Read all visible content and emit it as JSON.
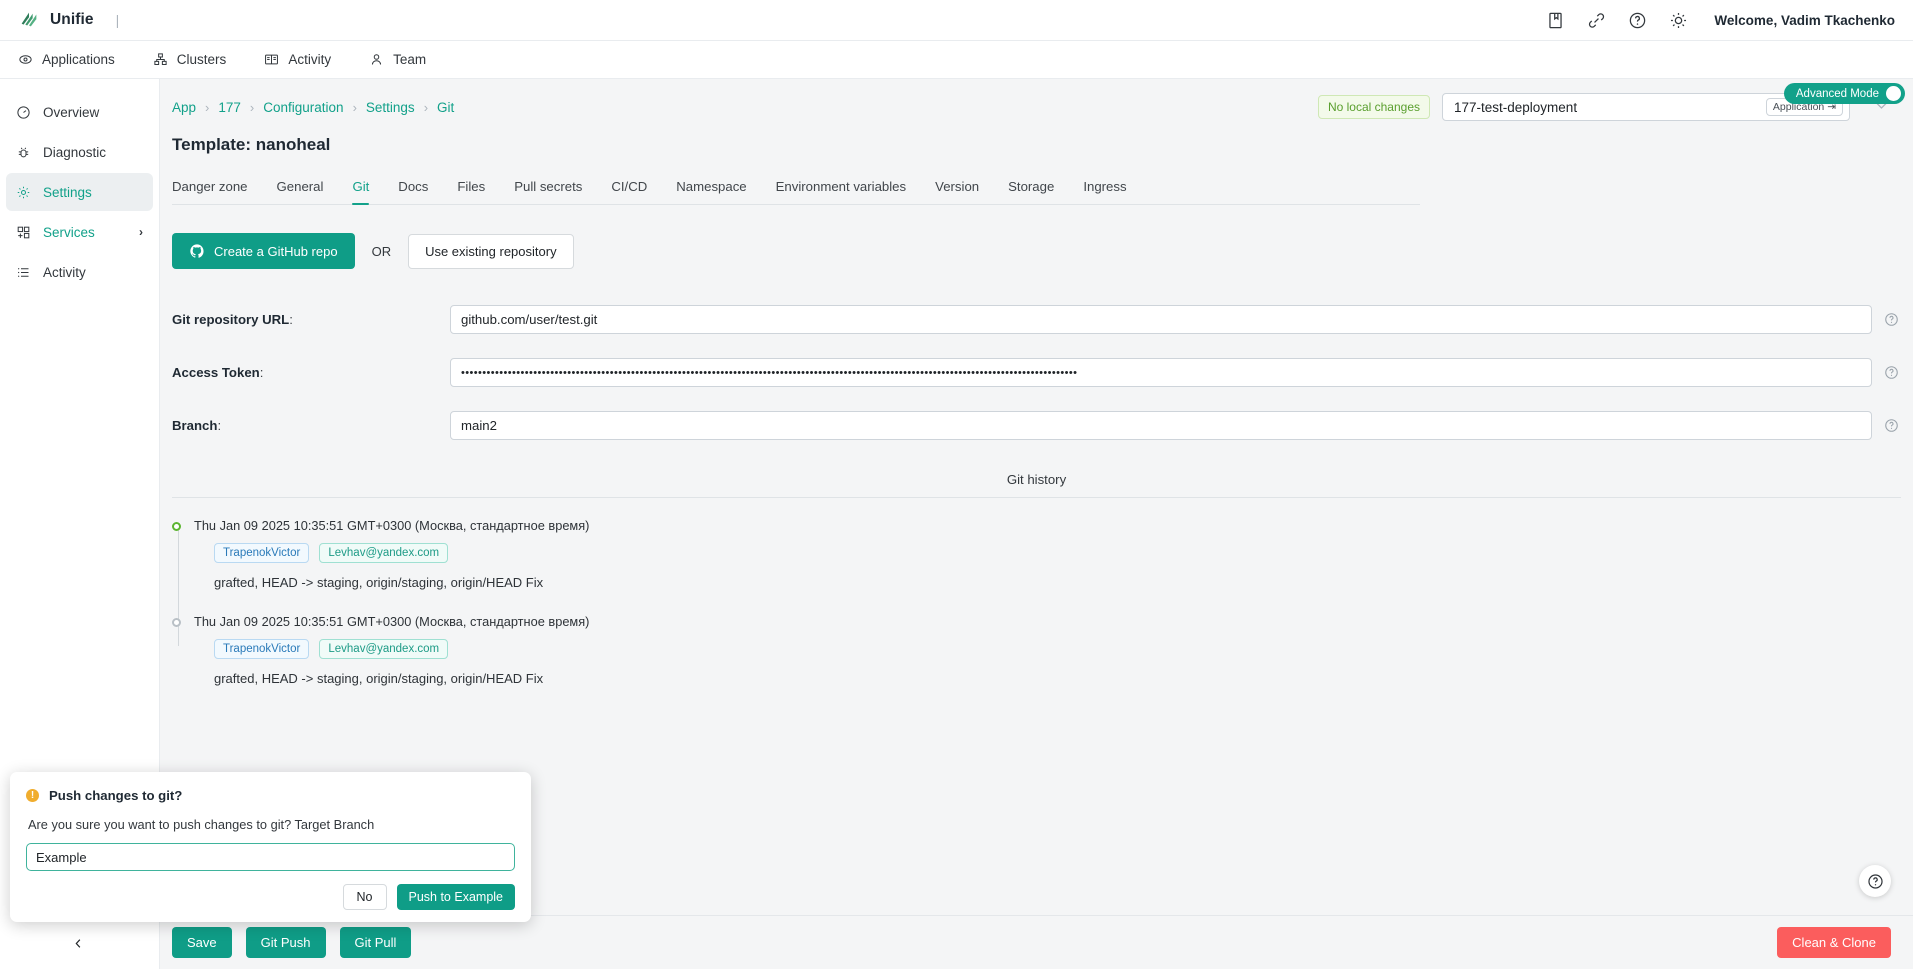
{
  "topbar": {
    "brand": "Unifie",
    "separator": "|",
    "icons": [
      "book-icon",
      "link-icon",
      "help-circle-icon",
      "sun-icon"
    ],
    "welcome": "Welcome, Vadim Tkachenko"
  },
  "nav": {
    "items": [
      {
        "label": "Applications",
        "icon": "apps-icon"
      },
      {
        "label": "Clusters",
        "icon": "clusters-icon"
      },
      {
        "label": "Activity",
        "icon": "activity-book-icon"
      },
      {
        "label": "Team",
        "icon": "person-icon"
      }
    ]
  },
  "sidebar": {
    "items": [
      {
        "label": "Overview",
        "icon": "gauge-icon",
        "active": false
      },
      {
        "label": "Diagnostic",
        "icon": "bug-icon",
        "active": false
      },
      {
        "label": "Settings",
        "icon": "gear-icon",
        "active": true
      },
      {
        "label": "Services",
        "icon": "grid-plus-icon",
        "active": false,
        "chevron": "›"
      },
      {
        "label": "Activity",
        "icon": "list-icon",
        "active": false
      }
    ],
    "collapse_icon": "‹"
  },
  "breadcrumb": {
    "items": [
      "App",
      "177",
      "Configuration",
      "Settings",
      "Git"
    ],
    "separator": "›"
  },
  "header": {
    "no_local_changes": "No local changes",
    "deployment_value": "177-test-deployment",
    "deployment_chip": "Application ⇥",
    "caret": "∨",
    "page_title": "Template: nanoheal"
  },
  "tabs": {
    "items": [
      "Danger zone",
      "General",
      "Git",
      "Docs",
      "Files",
      "Pull secrets",
      "CI/CD",
      "Namespace",
      "Environment variables",
      "Version",
      "Storage",
      "Ingress"
    ],
    "active": "Git",
    "advanced_mode_label": "Advanced Mode",
    "advanced_mode_on": true
  },
  "repo_actions": {
    "create_label": "Create a GitHub repo",
    "or_label": "OR",
    "existing_label": "Use existing repository"
  },
  "form": {
    "rows": [
      {
        "label": "Git repository URL",
        "colon": ":",
        "value": "github.com/user/test.git",
        "masked": false
      },
      {
        "label": "Access Token",
        "colon": ":",
        "value": "•••••••••••••••••••••••••••••••••••••••••••••••••••••••••••••••••••••••••••••••••••••••••••••••••••••••••••••••••••••••••••••••••••••••••••••••••",
        "masked": true
      },
      {
        "label": "Branch",
        "colon": ":",
        "value": "main2",
        "masked": false
      }
    ]
  },
  "history": {
    "title": "Git history",
    "commits": [
      {
        "date": "Thu Jan 09 2025 10:35:51 GMT+0300 (Москва, стандартное время)",
        "author": "TrapenokVictor",
        "email": "Levhav@yandex.com",
        "message": "grafted, HEAD -> staging, origin/staging, origin/HEAD Fix",
        "current": true
      },
      {
        "date": "Thu Jan 09 2025 10:35:51 GMT+0300 (Москва, стандартное время)",
        "author": "TrapenokVictor",
        "email": "Levhav@yandex.com",
        "message": "grafted, HEAD -> staging, origin/staging, origin/HEAD Fix",
        "current": false
      }
    ]
  },
  "modal": {
    "title": "Push changes to git?",
    "text": "Are you sure you want to push changes to git? Target Branch",
    "input_value": "Example",
    "no_label": "No",
    "push_label": "Push to Example"
  },
  "bottom": {
    "save": "Save",
    "git_push": "Git Push",
    "git_pull": "Git Pull",
    "clean_clone": "Clean & Clone"
  },
  "colors": {
    "teal": "#0f9d87",
    "accent_link": "#12a18a",
    "red": "#fb5d5d",
    "green_badge": "#5a9f2e",
    "warn": "#f0ad2e"
  }
}
